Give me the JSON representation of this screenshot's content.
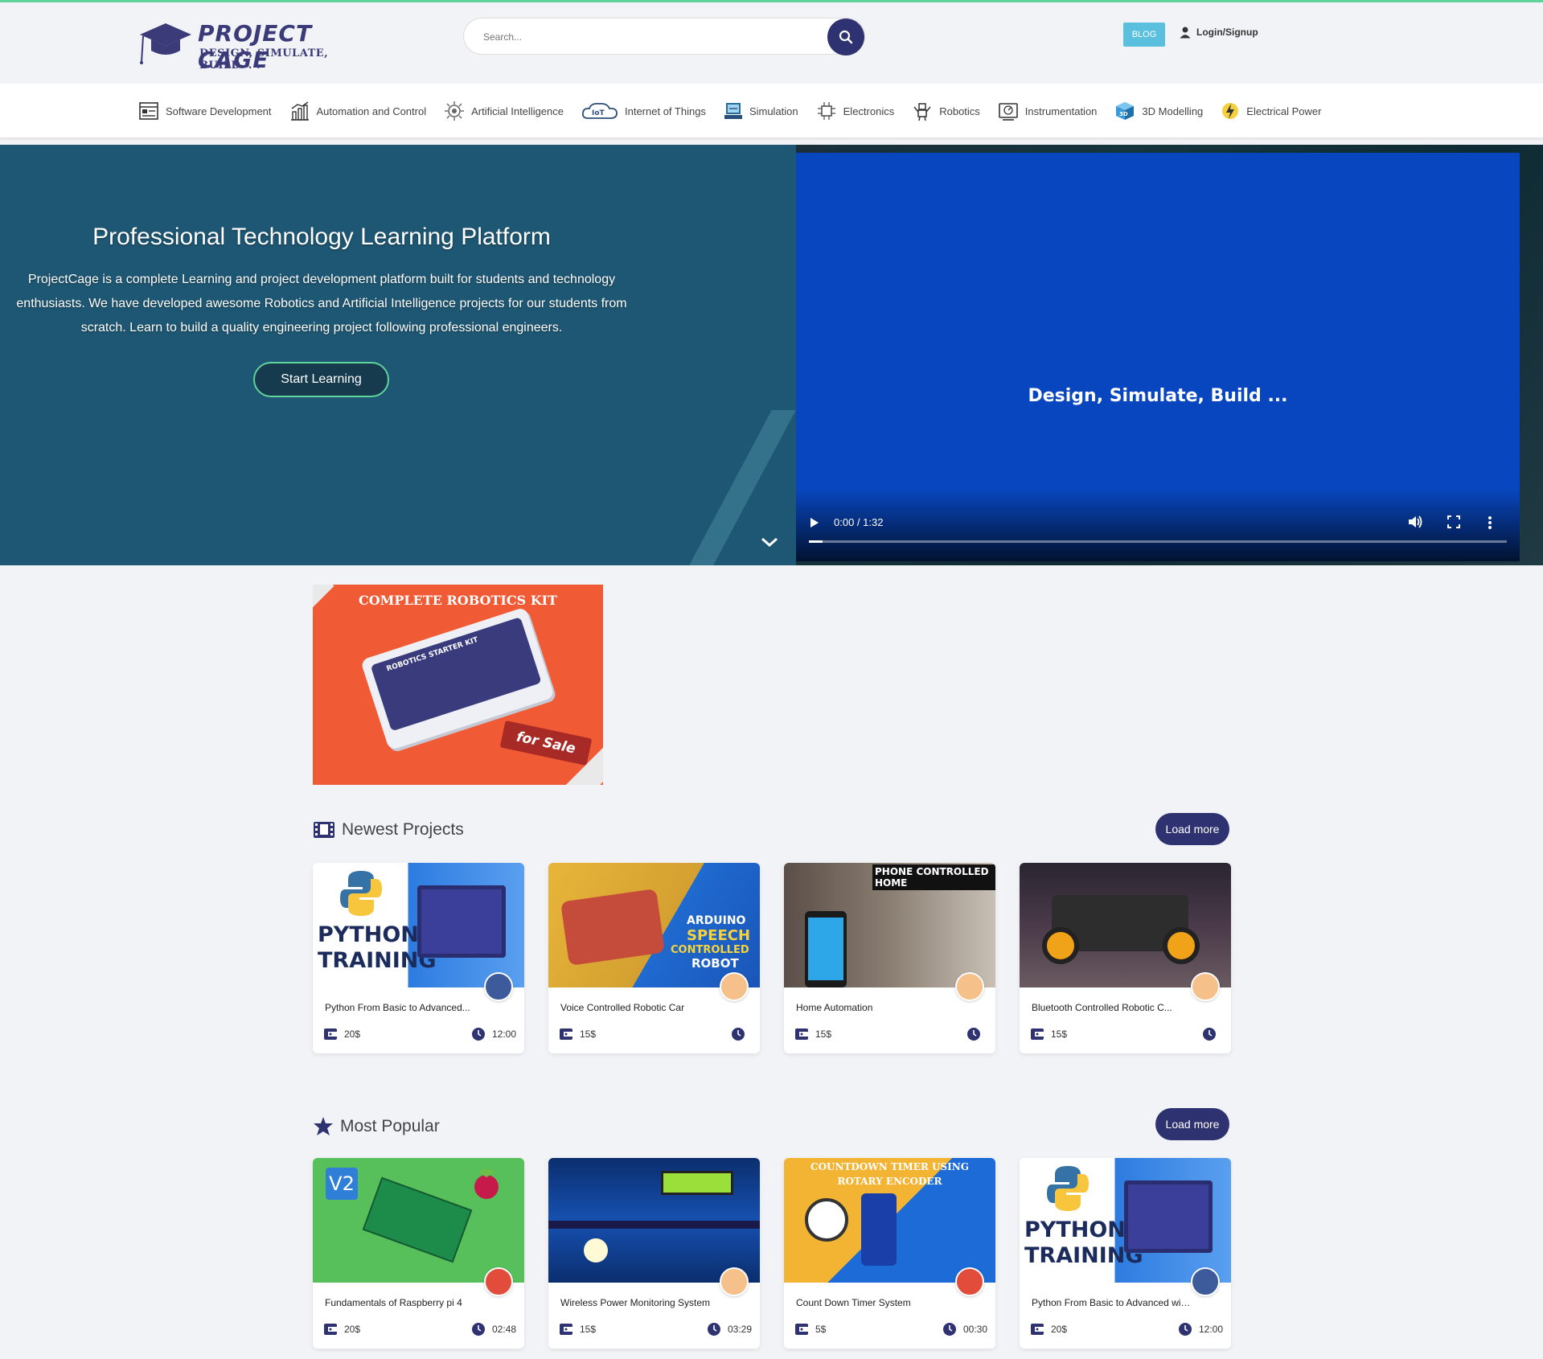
{
  "brand": {
    "name": "PROJECT CAGE",
    "tagline": "DESIGN, SIMULATE, BUILD. . ."
  },
  "search": {
    "placeholder": "Search..."
  },
  "header": {
    "blog_label": "BLOG",
    "login_label": "Login/Signup"
  },
  "categories": [
    {
      "label": "Software Development",
      "icon": "software-icon"
    },
    {
      "label": "Automation and Control",
      "icon": "automation-icon"
    },
    {
      "label": "Artificial Intelligence",
      "icon": "ai-chip-icon"
    },
    {
      "label": "Internet of Things",
      "icon": "iot-icon"
    },
    {
      "label": "Simulation",
      "icon": "simulation-icon"
    },
    {
      "label": "Electronics",
      "icon": "electronics-icon"
    },
    {
      "label": "Robotics",
      "icon": "robotics-icon"
    },
    {
      "label": "Instrumentation",
      "icon": "instrumentation-icon"
    },
    {
      "label": "3D Modelling",
      "icon": "3d-cube-icon"
    },
    {
      "label": "Electrical Power",
      "icon": "electrical-power-icon"
    }
  ],
  "hero": {
    "title": "Professional Technology Learning Platform",
    "description": "ProjectCage is a complete Learning and project development platform built for students and technology enthusiasts. We have developed awesome Robotics and Artificial Intelligence projects for our students from scratch. Learn to build a quality engineering project following professional engineers.",
    "cta_label": "Start Learning",
    "video": {
      "caption": "Design, Simulate, Build ...",
      "time": "0:00 / 1:32",
      "progress": 0.02
    }
  },
  "promo": {
    "title": "COMPLETE ROBOTICS KIT",
    "box_label": "ROBOTICS STARTER KIT",
    "tag": "for Sale"
  },
  "sections": {
    "newest": {
      "title": "Newest Projects",
      "load_more": "Load more",
      "cards": [
        {
          "title": "Python From Basic to Advanced...",
          "price": "20$",
          "duration": "12:00",
          "image_text_1": "PYTHON",
          "image_text_2": "TRAINING"
        },
        {
          "title": "Voice Controlled Robotic Car",
          "price": "15$",
          "duration": "",
          "image_text_1": "ARDUINO",
          "image_text_2": "SPEECH",
          "image_text_3": "CONTROLLED",
          "image_text_4": "ROBOT"
        },
        {
          "title": "Home Automation",
          "price": "15$",
          "duration": "",
          "image_text_1": "PHONE CONTROLLED HOME"
        },
        {
          "title": "Bluetooth Controlled Robotic C...",
          "price": "15$",
          "duration": ""
        }
      ]
    },
    "popular": {
      "title": "Most Popular",
      "load_more": "Load more",
      "cards": [
        {
          "title": "Fundamentals of Raspberry pi 4",
          "price": "20$",
          "duration": "02:48"
        },
        {
          "title": "Wireless Power Monitoring System",
          "price": "15$",
          "duration": "03:29"
        },
        {
          "title": "Count Down Timer System",
          "price": "5$",
          "duration": "00:30",
          "image_text_1": "COUNTDOWN TIMER USING",
          "image_text_2": "ROTARY ENCODER"
        },
        {
          "title": "Python From Basic to Advanced with...",
          "price": "20$",
          "duration": "12:00",
          "image_text_1": "PYTHON",
          "image_text_2": "TRAINING"
        }
      ]
    }
  },
  "colors": {
    "accent": "#2f3270",
    "hero_bg": "#1e5773",
    "green": "#5fd39a",
    "video_bg": "#0846bf",
    "promo_bg": "#f05a34",
    "blog": "#5bc0de"
  }
}
